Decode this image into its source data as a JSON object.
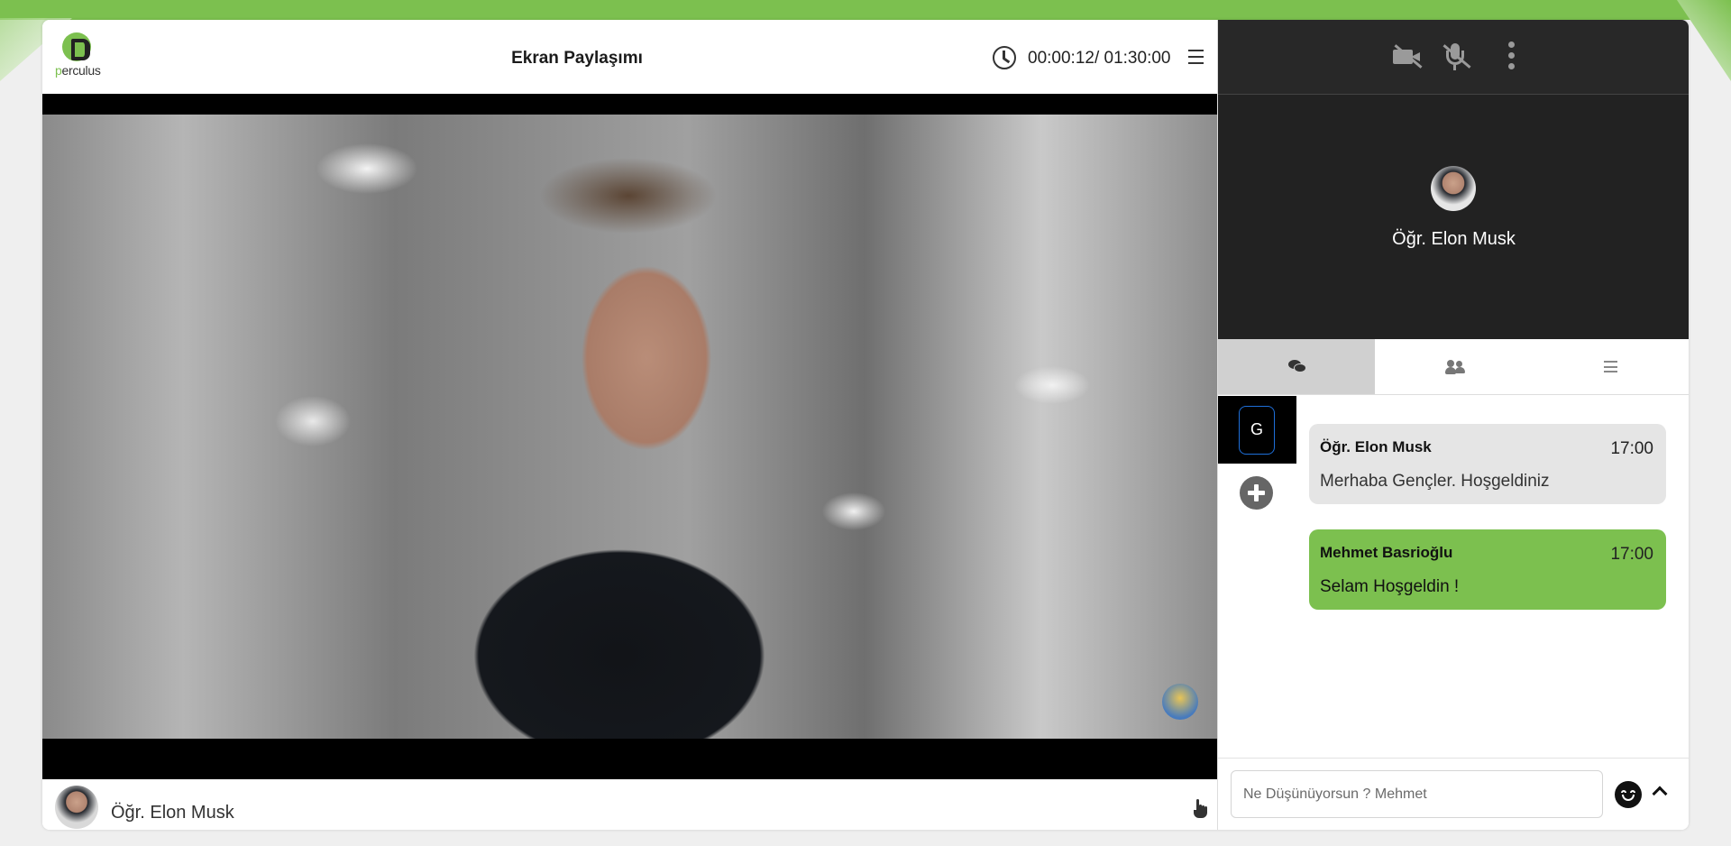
{
  "colors": {
    "brand_green": "#7cc04f",
    "dark_panel": "#222222",
    "focus_blue": "#1e6fd9"
  },
  "logo": {
    "text_accent": "p",
    "text_rest": "erculus"
  },
  "header": {
    "title": "Ekran Paylaşımı",
    "timer": "00:00:12/ 01:30:00",
    "icons": [
      "clock-icon",
      "menu-icon"
    ]
  },
  "video": {
    "watermark": "watermark-badge"
  },
  "footer": {
    "speaker_name": "Öğr. Elon Musk",
    "icons": [
      "raise-hand-icon"
    ]
  },
  "side": {
    "controls": [
      "camera-off-icon",
      "mic-off-icon",
      "more-vertical-icon"
    ],
    "presenter_name": "Öğr. Elon Musk",
    "tabs": [
      {
        "icon": "chat-icon",
        "active": true
      },
      {
        "icon": "users-icon",
        "active": false
      },
      {
        "icon": "list-icon",
        "active": false
      }
    ],
    "rooms": [
      {
        "label": "G",
        "active": true
      }
    ],
    "add_room_icon": "plus-circle-icon"
  },
  "messages": [
    {
      "sender": "Öğr. Elon Musk",
      "time": "17:00",
      "text": "Merhaba Gençler. Hoşgeldiniz"
    },
    {
      "sender": "Mehmet Basrioğlu",
      "time": "17:00",
      "text": "Selam Hoşgeldin !"
    }
  ],
  "composer": {
    "placeholder": "Ne Düşünüyorsun ? Mehmet",
    "value": "",
    "icons": [
      "emoji-icon",
      "chevron-up-icon"
    ]
  }
}
